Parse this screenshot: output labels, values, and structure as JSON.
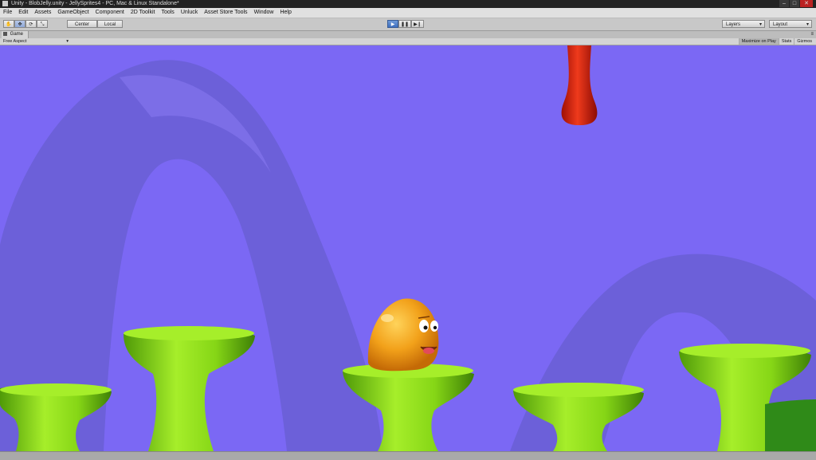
{
  "window": {
    "title": "Unity - BlobJelly.unity - JellySprites4 - PC, Mac & Linux Standalone*",
    "controls": [
      "–",
      "□",
      "✕"
    ]
  },
  "menu": [
    "File",
    "Edit",
    "Assets",
    "GameObject",
    "Component",
    "2D Toolkit",
    "Tools",
    "Unluck",
    "Asset Store Tools",
    "Window",
    "Help"
  ],
  "toolbar": {
    "tools": [
      {
        "icon": "hand-icon",
        "glyph": "✋"
      },
      {
        "icon": "move-icon",
        "glyph": "✥"
      },
      {
        "icon": "rotate-icon",
        "glyph": "⟳"
      },
      {
        "icon": "scale-icon",
        "glyph": "⤡"
      }
    ],
    "pivot_label": "Center",
    "space_label": "Local",
    "playback": [
      {
        "icon": "play-icon",
        "glyph": "▶"
      },
      {
        "icon": "pause-icon",
        "glyph": "❚❚"
      },
      {
        "icon": "step-icon",
        "glyph": "▶❙"
      }
    ],
    "layers_label": "Layers",
    "layout_label": "Layout"
  },
  "game_tab": {
    "label": "Game",
    "aspect": "Free Aspect",
    "maximize_label": "Maximize on Play",
    "stats_label": "Stats",
    "gizmos_label": "Gizmos"
  },
  "colors": {
    "sky": "#7b68f4",
    "rock": "#6a5fd6",
    "platform": "#86d616",
    "blob": "#f2a11a",
    "drip": "#d71c0c"
  }
}
